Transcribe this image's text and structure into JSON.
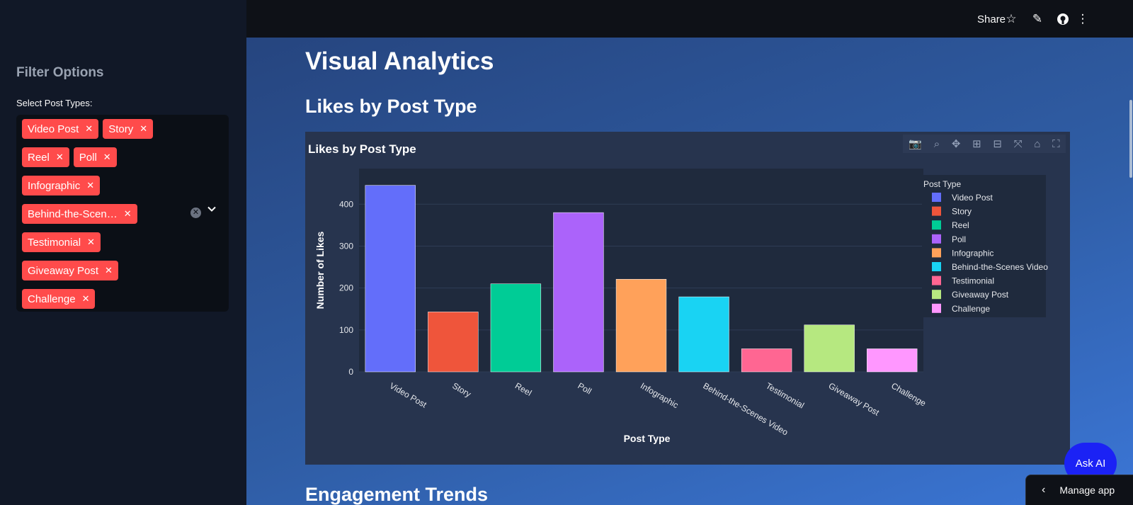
{
  "header": {
    "share_label": "Share",
    "icons": [
      "star-icon",
      "pencil-icon",
      "github-icon",
      "more-vertical-icon"
    ]
  },
  "sidebar": {
    "title": "Filter Options",
    "select_label": "Select Post Types:",
    "chips": [
      "Video Post",
      "Story",
      "Reel",
      "Poll",
      "Infographic",
      "Behind-the-Scen…",
      "Testimonial",
      "Giveaway Post",
      "Challenge"
    ]
  },
  "main": {
    "title": "Visual Analytics",
    "section1": "Likes by Post Type",
    "section2": "Engagement Trends"
  },
  "ask_ai_label": "Ask AI",
  "manage_app_label": "Manage app",
  "chart_data": {
    "type": "bar",
    "title": "Likes by Post Type",
    "xlabel": "Post Type",
    "ylabel": "Number of Likes",
    "categories": [
      "Video Post",
      "Story",
      "Reel",
      "Poll",
      "Infographic",
      "Behind-the-Scenes Video",
      "Testimonial",
      "Giveaway Post",
      "Challenge"
    ],
    "values": [
      445,
      143,
      210,
      380,
      221,
      179,
      55,
      112,
      55
    ],
    "colors": [
      "#636efa",
      "#ef553b",
      "#00cc96",
      "#ab63fa",
      "#ffa15a",
      "#19d3f3",
      "#ff6692",
      "#b6e880",
      "#ff97ff"
    ],
    "ylim": [
      0,
      485
    ],
    "yticks": [
      0,
      100,
      200,
      300,
      400
    ],
    "legend_title": "Post Type",
    "legend_position": "right",
    "grid": true
  }
}
